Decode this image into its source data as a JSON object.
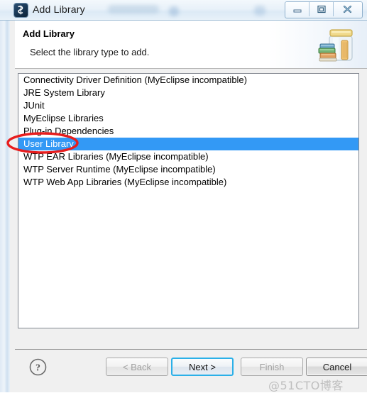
{
  "window": {
    "title": "Add Library",
    "icon": "eclipse-app-icon",
    "controls": [
      {
        "name": "minimize",
        "glyph": "minimize-icon"
      },
      {
        "name": "restore",
        "glyph": "restore-icon"
      },
      {
        "name": "close",
        "glyph": "close-icon"
      }
    ]
  },
  "header": {
    "title": "Add Library",
    "subtitle": "Select the library type to add.",
    "icon": "library-jar-books-icon"
  },
  "library_list": {
    "selected_index": 5,
    "items": [
      "Connectivity Driver Definition (MyEclipse incompatible)",
      "JRE System Library",
      "JUnit",
      "MyEclipse Libraries",
      "Plug-in Dependencies",
      "User Library",
      "WTP EAR Libraries (MyEclipse incompatible)",
      "WTP Server Runtime (MyEclipse incompatible)",
      "WTP Web App Libraries (MyEclipse incompatible)"
    ]
  },
  "annotation": {
    "shape": "ellipse",
    "color": "#e81d1d",
    "target": "User Library"
  },
  "buttons": {
    "help": "?",
    "back": "< Back",
    "next": "Next >",
    "finish": "Finish",
    "cancel": "Cancel"
  },
  "watermark": "@51CTO博客",
  "colors": {
    "selection_blue": "#3399f5",
    "focus_border": "#2bb0e8",
    "annotation_red": "#e81d1d",
    "dialog_bg": "#f0f0f0",
    "titlebar_bg": "#e8f1f9"
  }
}
